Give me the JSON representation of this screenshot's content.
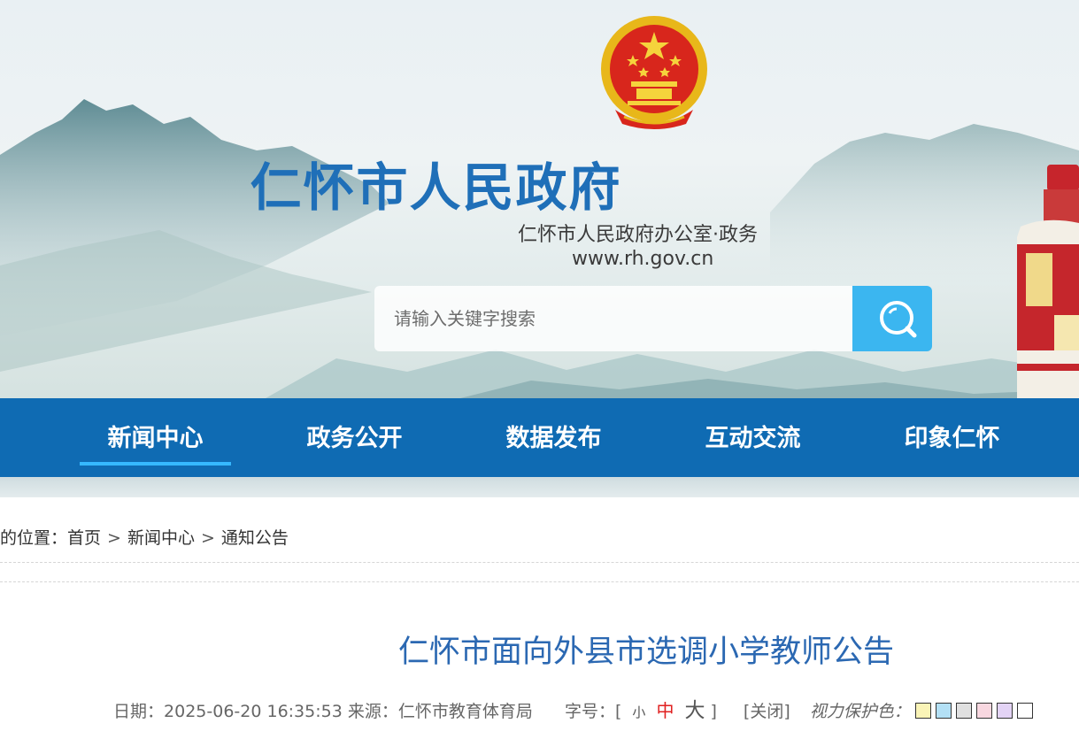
{
  "header": {
    "site_title": "仁怀市人民政府",
    "site_subtitle": "仁怀市人民政府办公室·政务",
    "site_url": "www.rh.gov.cn",
    "emblem_icon": "national-emblem-icon"
  },
  "search": {
    "placeholder": "请输入关键字搜索",
    "value": "",
    "button_icon": "search-icon",
    "button_color": "#3bb6f0"
  },
  "nav": {
    "background": "#0f6bb3",
    "active_color": "#36b8ff",
    "items": [
      {
        "label": "新闻中心",
        "active": true
      },
      {
        "label": "政务公开"
      },
      {
        "label": "数据发布"
      },
      {
        "label": "互动交流"
      },
      {
        "label": "印象仁怀"
      }
    ]
  },
  "breadcrumb": {
    "prefix": "的位置：",
    "items": [
      "首页",
      "新闻中心",
      "通知公告"
    ],
    "separator": ">"
  },
  "article": {
    "title": "仁怀市面向外县市选调小学教师公告",
    "title_color": "#2b68b2",
    "date_label": "日期：",
    "date": "2025-06-20 16:35:53",
    "source_label": "来源：",
    "source": "仁怀市教育体育局",
    "fontsize_label": "字号：",
    "bracket_open": "[",
    "bracket_close": "]",
    "font_small": "小",
    "font_medium": "中",
    "font_large": "大",
    "close_label": "[关闭]",
    "eye_color_label": "视力保护色：",
    "eye_colors": [
      "#faf4b7",
      "#b3e0f5",
      "#e0e0e0",
      "#f8d7e0",
      "#e3d3f5",
      "#ffffff"
    ]
  }
}
